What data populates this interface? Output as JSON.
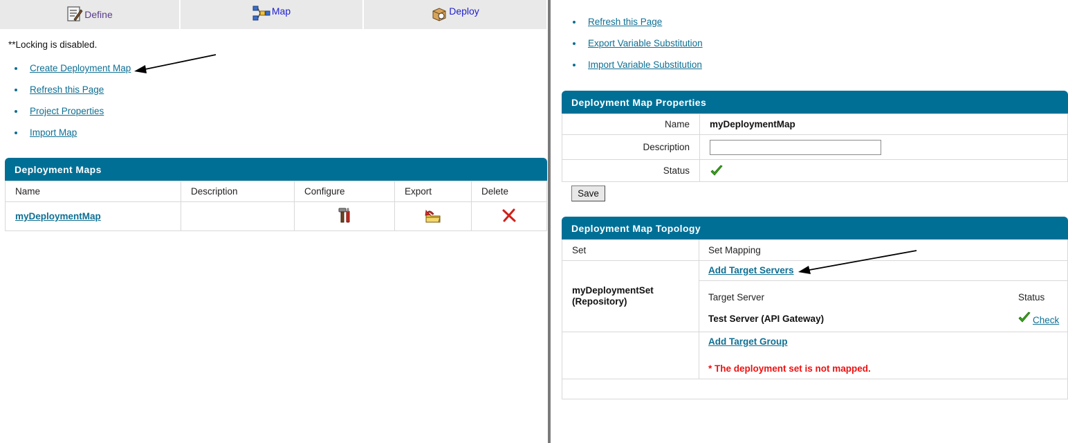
{
  "tabs": [
    {
      "label": "Define",
      "icon": "define-icon"
    },
    {
      "label": "Map",
      "icon": "map-icon"
    },
    {
      "label": "Deploy",
      "icon": "deploy-icon"
    }
  ],
  "left": {
    "locking_message": "**Locking is disabled.",
    "links": [
      "Create Deployment Map",
      "Refresh this Page",
      "Project Properties",
      "Import Map"
    ],
    "maps_panel": {
      "title": "Deployment Maps",
      "columns": [
        "Name",
        "Description",
        "Configure",
        "Export",
        "Delete"
      ],
      "rows": [
        {
          "name": "myDeploymentMap",
          "description": "",
          "configure_icon": "tools-icon",
          "export_icon": "export-icon",
          "delete_icon": "delete-x-icon"
        }
      ]
    }
  },
  "right": {
    "links": [
      "Refresh this Page",
      "Export Variable Substitution",
      "Import Variable Substitution"
    ],
    "properties_panel": {
      "title": "Deployment Map Properties",
      "name_label": "Name",
      "name_value": "myDeploymentMap",
      "description_label": "Description",
      "description_value": "",
      "status_label": "Status",
      "status_icon": "green-check-icon",
      "save_label": "Save"
    },
    "topology_panel": {
      "title": "Deployment Map Topology",
      "set_header": "Set",
      "set_mapping_header": "Set Mapping",
      "set_name": "myDeploymentSet",
      "set_type": "(Repository)",
      "add_target_servers": "Add Target Servers",
      "target_server_header": "Target Server",
      "status_header": "Status",
      "target_server": "Test Server (API Gateway)",
      "check_label": "Check",
      "add_target_group": "Add Target Group",
      "error_message": "* The deployment set is not mapped."
    }
  },
  "colors": {
    "panel_header": "#006f96",
    "link": "#0e6f93",
    "error": "#ee1111",
    "check": "#3aa41c"
  }
}
